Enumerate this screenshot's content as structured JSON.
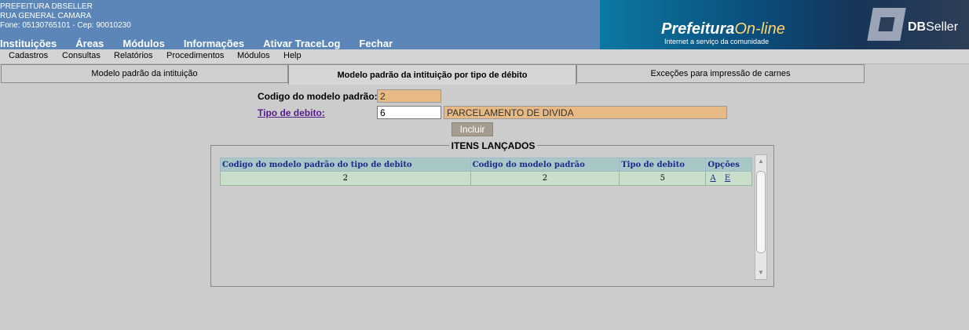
{
  "header": {
    "org": "PREFEITURA DBSELLER",
    "street": "RUA GENERAL CAMARA",
    "phone_zip": "Fone: 05130765101  -  Cep: 90010230",
    "menu": [
      "Instituições",
      "Áreas",
      "Módulos",
      "Informações",
      "Ativar TraceLog",
      "Fechar"
    ],
    "brand_a": "Prefeitura",
    "brand_b": "On-line",
    "brand_tag": "Internet a serviço da comunidade",
    "db_logo_bold": "DB",
    "db_logo_rest": "Seller"
  },
  "submenu": [
    "Cadastros",
    "Consultas",
    "Relatórios",
    "Procedimentos",
    "Módulos",
    "Help"
  ],
  "tabs": [
    "Modelo padrão da intituição",
    "Modelo padrão da intituição por tipo de débito",
    "Exceções para impressão de carnes"
  ],
  "form": {
    "codigo_label": "Codigo do modelo padrão:",
    "codigo_value": "2",
    "tipo_label": "Tipo de debito:",
    "tipo_value": "6",
    "tipo_desc": "PARCELAMENTO DE DIVIDA",
    "incluir_label": "Incluir"
  },
  "itens": {
    "legend": "ITENS LANÇADOS",
    "columns": [
      "Codigo do modelo padrão do tipo de debito",
      "Codigo do modelo padrão",
      "Tipo de debito",
      "Opções"
    ],
    "rows": [
      {
        "c1": "2",
        "c2": "2",
        "c3": "5",
        "a": "A",
        "e": "E"
      }
    ]
  },
  "colors": {
    "header": "#5b86b7",
    "readonly_field": "#e6b985",
    "table_header": "#a8c8c8",
    "table_row": "#c9dfc9"
  }
}
